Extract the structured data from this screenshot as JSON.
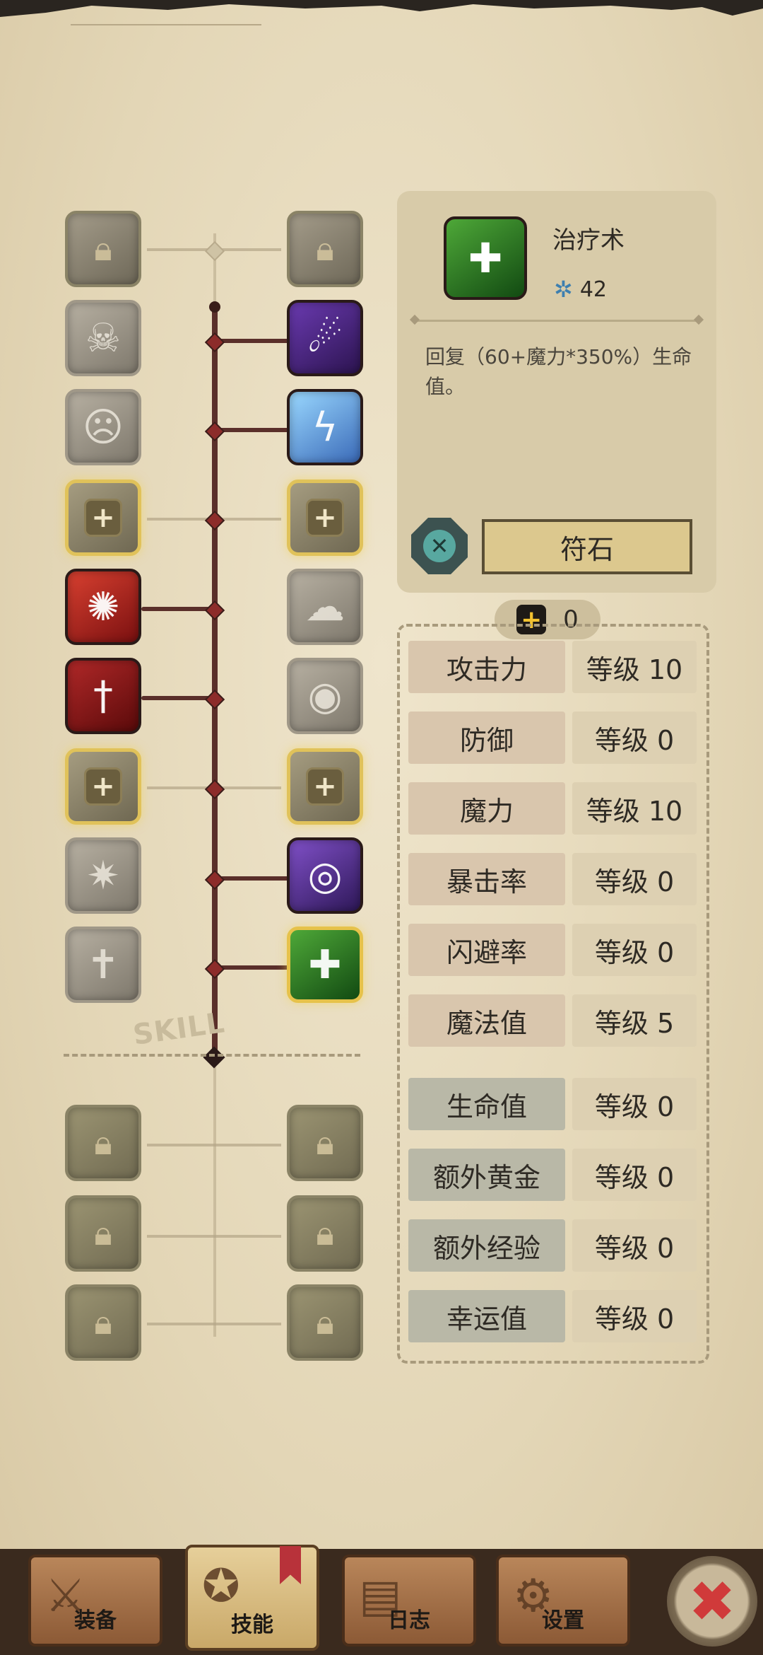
{
  "skill_tree": {
    "watermark": "SKILL",
    "rows": [
      {
        "left": {
          "icon": "lock-icon",
          "state": "locked-gray"
        },
        "right": {
          "icon": "lock-icon",
          "state": "locked-gray"
        }
      },
      {
        "left": {
          "icon": "bone-strike-icon",
          "state": "inactive"
        },
        "right": {
          "icon": "shadow-claw-icon",
          "state": "learned",
          "color": "purple"
        }
      },
      {
        "left": {
          "icon": "scream-icon",
          "state": "inactive"
        },
        "right": {
          "icon": "lightning-icon",
          "state": "learned",
          "color": "blue"
        }
      },
      {
        "left": {
          "icon": "plus-icon",
          "state": "slot"
        },
        "right": {
          "icon": "plus-icon",
          "state": "slot"
        }
      },
      {
        "left": {
          "icon": "blood-slash-icon",
          "state": "learned",
          "color": "red"
        },
        "right": {
          "icon": "storm-icon",
          "state": "inactive"
        }
      },
      {
        "left": {
          "icon": "dagger-icon",
          "state": "learned",
          "color": "crimson"
        },
        "right": {
          "icon": "eye-burst-icon",
          "state": "inactive"
        }
      },
      {
        "left": {
          "icon": "plus-icon",
          "state": "slot"
        },
        "right": {
          "icon": "plus-icon",
          "state": "slot"
        }
      },
      {
        "left": {
          "icon": "shatter-icon",
          "state": "inactive"
        },
        "right": {
          "icon": "vortex-icon",
          "state": "learned",
          "color": "violet"
        }
      },
      {
        "left": {
          "icon": "cross-sword-icon",
          "state": "inactive"
        },
        "right": {
          "icon": "heal-icon",
          "state": "selected",
          "color": "green"
        }
      }
    ],
    "locked_rows": 3
  },
  "selected_skill": {
    "name": "治疗术",
    "mana_cost": "42",
    "description": "回复（60+魔力*350%）生命值。",
    "icon": "heal-icon"
  },
  "rune": {
    "button_label": "符石",
    "icon": "rune-x-icon"
  },
  "points": {
    "value": "0"
  },
  "attributes": [
    {
      "label": "攻击力",
      "level": "等级 10",
      "tone": "warm"
    },
    {
      "label": "防御",
      "level": "等级 0",
      "tone": "warm"
    },
    {
      "label": "魔力",
      "level": "等级 10",
      "tone": "warm"
    },
    {
      "label": "暴击率",
      "level": "等级 0",
      "tone": "warm"
    },
    {
      "label": "闪避率",
      "level": "等级 0",
      "tone": "warm"
    },
    {
      "label": "魔法值",
      "level": "等级 5",
      "tone": "warm"
    },
    {
      "label": "生命值",
      "level": "等级 0",
      "tone": "cool"
    },
    {
      "label": "额外黄金",
      "level": "等级 0",
      "tone": "cool"
    },
    {
      "label": "额外经验",
      "level": "等级 0",
      "tone": "cool"
    },
    {
      "label": "幸运值",
      "level": "等级 0",
      "tone": "cool"
    }
  ],
  "nav": {
    "equipment": "装备",
    "skills": "技能",
    "log": "日志",
    "settings": "设置"
  },
  "colors": {
    "spine": "#5a2f2a",
    "slot_glow": "#e0c25a",
    "close_x": "#d03a3a"
  }
}
